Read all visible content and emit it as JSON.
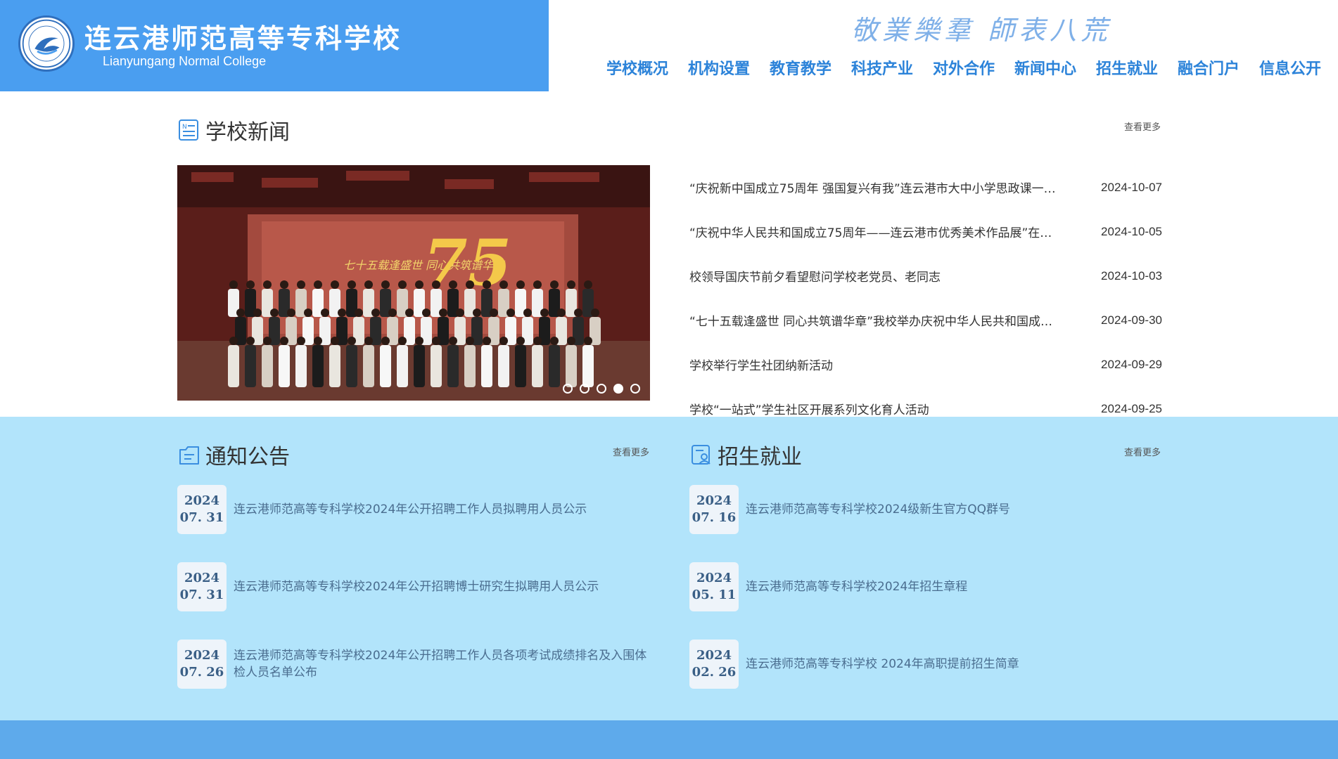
{
  "header": {
    "logo_cn": "连云港师范高等专科学校",
    "logo_en": "Lianyungang Normal College",
    "motto": "敬業樂羣 師表八荒",
    "nav": [
      "学校概况",
      "机构设置",
      "教育教学",
      "科技产业",
      "对外合作",
      "新闻中心",
      "招生就业",
      "融合门户",
      "信息公开"
    ]
  },
  "news": {
    "title": "学校新闻",
    "more": "查看更多",
    "carousel": {
      "slide_text": "七十五载逢盛世 同心共筑谱华章",
      "badge": "75",
      "dot_count": 5,
      "active_dot": 4
    },
    "items": [
      {
        "title": "“庆祝新中国成立75周年 强国复兴有我”连云港市大中小学思政课一…",
        "date": "2024-10-07"
      },
      {
        "title": "“庆祝中华人民共和国成立75周年——连云港市优秀美术作品展”在…",
        "date": "2024-10-05"
      },
      {
        "title": "校领导国庆节前夕看望慰问学校老党员、老同志",
        "date": "2024-10-03"
      },
      {
        "title": "“七十五载逢盛世 同心共筑谱华章”我校举办庆祝中华人民共和国成…",
        "date": "2024-09-30"
      },
      {
        "title": "学校举行学生社团纳新活动",
        "date": "2024-09-29"
      },
      {
        "title": "学校“一站式”学生社区开展系列文化育人活动",
        "date": "2024-09-25"
      }
    ]
  },
  "notices": {
    "title": "通知公告",
    "more": "查看更多",
    "items": [
      {
        "year": "2024",
        "md": "07. 31",
        "text": "连云港师范高等专科学校2024年公开招聘工作人员拟聘用人员公示"
      },
      {
        "year": "2024",
        "md": "07. 31",
        "text": "连云港师范高等专科学校2024年公开招聘博士研究生拟聘用人员公示"
      },
      {
        "year": "2024",
        "md": "07. 26",
        "text": "连云港师范高等专科学校2024年公开招聘工作人员各项考试成绩排名及入围体检人员名单公布"
      }
    ]
  },
  "admissions": {
    "title": "招生就业",
    "more": "查看更多",
    "items": [
      {
        "year": "2024",
        "md": "07. 16",
        "text": "连云港师范高等专科学校2024级新生官方QQ群号"
      },
      {
        "year": "2024",
        "md": "05. 11",
        "text": "连云港师范高等专科学校2024年招生章程"
      },
      {
        "year": "2024",
        "md": "02. 26",
        "text": "连云港师范高等专科学校 2024年高职提前招生简章"
      }
    ]
  },
  "colors": {
    "brand": "#4a9ef0",
    "nav": "#2c83d9",
    "band": "#b2e4fb",
    "footer": "#5eaaeb"
  }
}
